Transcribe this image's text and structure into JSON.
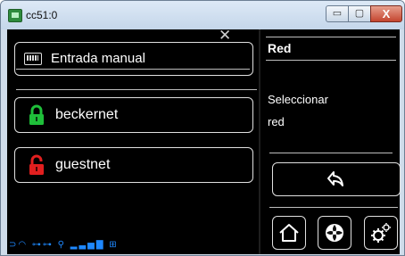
{
  "window": {
    "title": "cc51:0",
    "minimize_label": "▭",
    "maximize_label": "▢",
    "close_label": "X"
  },
  "left_panel": {
    "close_mark": "✕",
    "manual_entry_label": "Entrada manual",
    "networks": [
      {
        "name": "beckernet",
        "lock_color": "#1fbf3a",
        "locked": true
      },
      {
        "name": "guestnet",
        "lock_color": "#e11f1f",
        "locked": false
      }
    ],
    "status_icons": "⊃◠ ⊶⊶ ⚲ ▂▃▅▇ ⊞"
  },
  "right_panel": {
    "title": "Red",
    "line1": "Seleccionar",
    "line2": "red"
  },
  "icons": {
    "back": "back-arrow-icon",
    "home": "home-icon",
    "fan": "fan-icon",
    "settings": "gear-icon"
  }
}
